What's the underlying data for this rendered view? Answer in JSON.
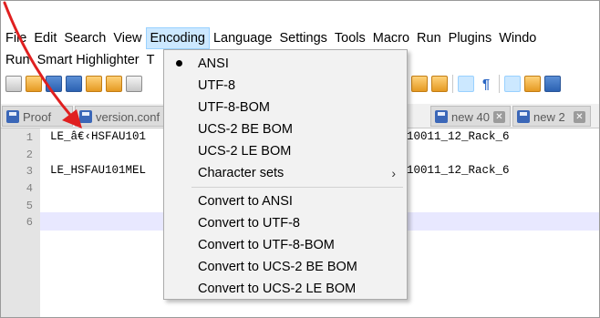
{
  "menubar": {
    "row1": [
      "File",
      "Edit",
      "Search",
      "View",
      "Encoding",
      "Language",
      "Settings",
      "Tools",
      "Macro",
      "Run",
      "Plugins",
      "Windo"
    ],
    "row2": [
      "Run",
      "Smart Highlighter",
      "T"
    ]
  },
  "tabs": [
    {
      "label": "Proof"
    },
    {
      "label": "version.conf"
    },
    {
      "label": "new 40"
    },
    {
      "label": "new 2"
    }
  ],
  "close_glyph": "✕",
  "editor": {
    "line_numbers": [
      "1",
      "2",
      "3",
      "4",
      "5",
      "6"
    ],
    "lines": [
      {
        "left": "LE_â€‹HSFAU101",
        "right": "10011_12_Rack_6"
      },
      {
        "left": "",
        "right": ""
      },
      {
        "left": "LE_HSFAU101MEL",
        "right": "10011_12_Rack_6"
      },
      {
        "left": "",
        "right": ""
      },
      {
        "left": "",
        "right": ""
      },
      {
        "left": "",
        "right": ""
      }
    ]
  },
  "encoding_menu": {
    "items": [
      "ANSI",
      "UTF-8",
      "UTF-8-BOM",
      "UCS-2 BE BOM",
      "UCS-2 LE BOM",
      "Character sets"
    ],
    "convert_items": [
      "Convert to ANSI",
      "Convert to UTF-8",
      "Convert to UTF-8-BOM",
      "Convert to UCS-2 BE BOM",
      "Convert to UCS-2 LE BOM"
    ],
    "selected": "ANSI",
    "submenu_indicator": "›"
  },
  "colors": {
    "menu_highlight": "#cce8ff",
    "arrow": "#e02020",
    "current_line": "#e8e8ff"
  }
}
